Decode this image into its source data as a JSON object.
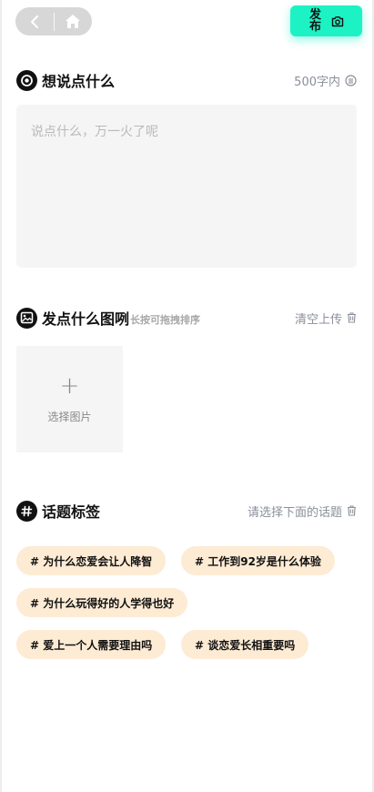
{
  "header": {
    "publish_label": "发布"
  },
  "post": {
    "title": "想说点什么",
    "limit": "500字内",
    "placeholder": "说点什么，万一火了呢"
  },
  "images": {
    "title": "发点什么图咧",
    "hint": "长按可拖拽排序",
    "clear_label": "清空上传",
    "picker_label": "选择图片"
  },
  "topics": {
    "title": "话题标签",
    "hint": "请选择下面的话题",
    "tags": [
      "# 为什么恋爱会让人降智",
      "# 工作到92岁是什么体验",
      "# 为什么玩得好的人学得也好",
      "# 爱上一个人需要理由吗",
      "# 谈恋爱长相重要吗"
    ]
  },
  "colors": {
    "accent": "#1df2c5",
    "tag_bg": "#fdebd4",
    "input_bg": "#f5f5f5"
  }
}
